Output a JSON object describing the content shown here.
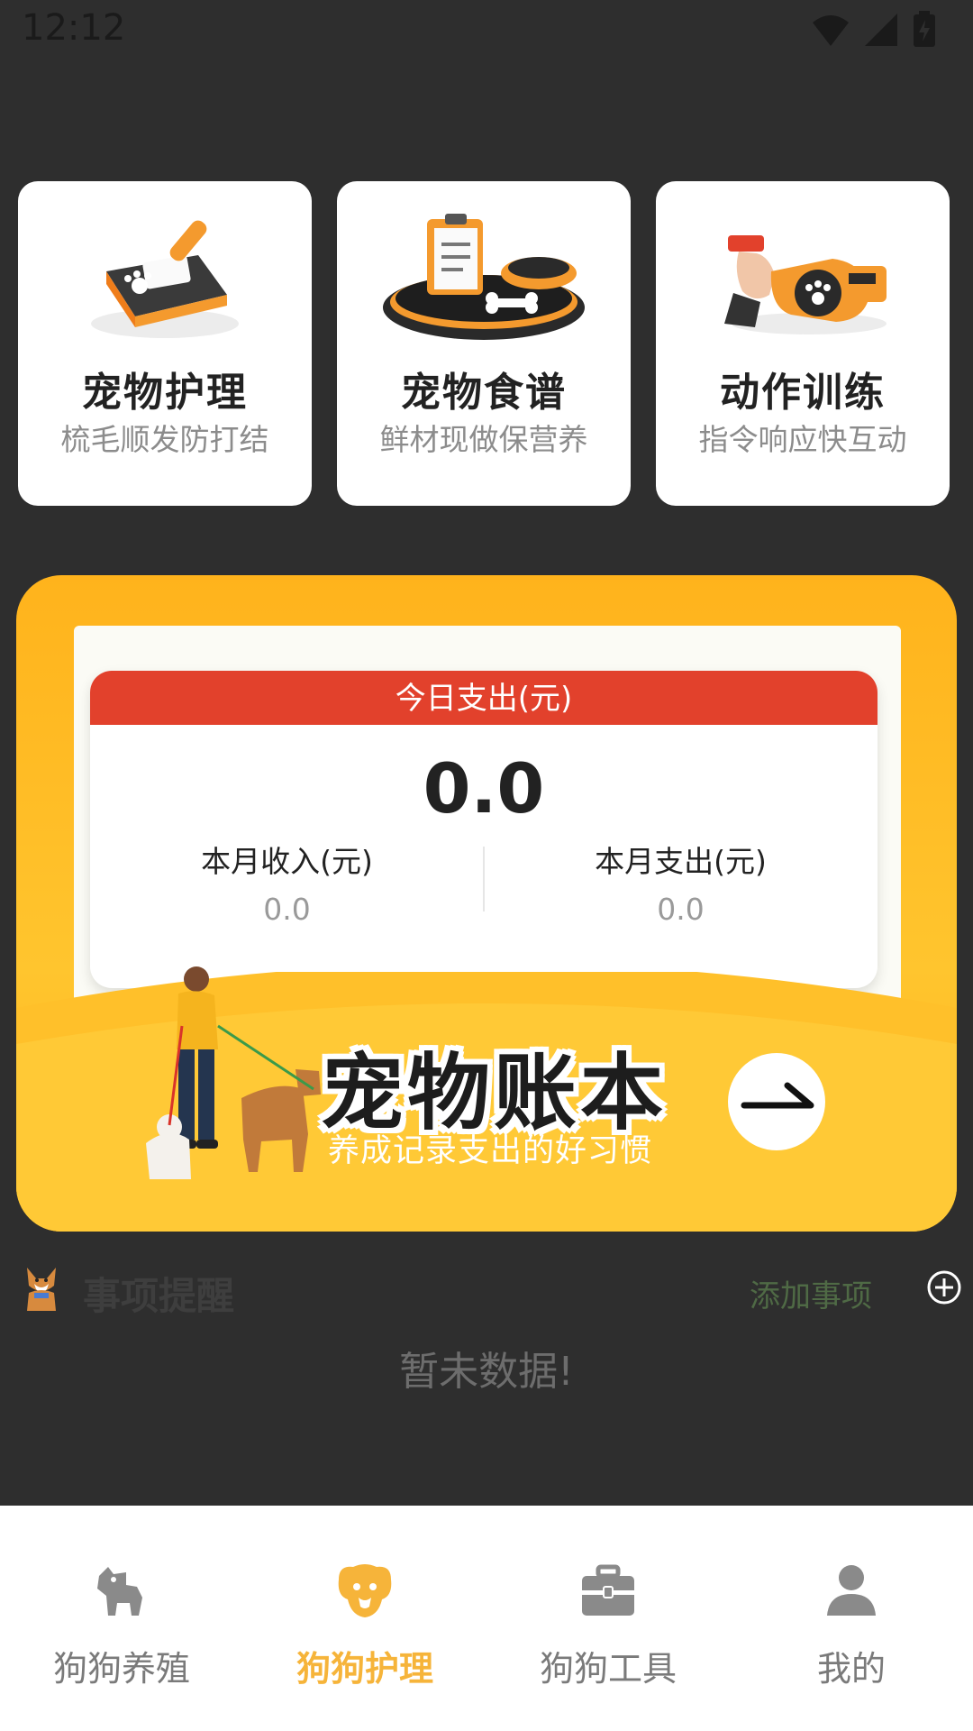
{
  "status_bar": {
    "time": "12:12"
  },
  "features": [
    {
      "title": "宠物护理",
      "subtitle": "梳毛顺发防打结",
      "icon": "grooming-brush-icon"
    },
    {
      "title": "宠物食谱",
      "subtitle": "鲜材现做保营养",
      "icon": "food-bowl-icon"
    },
    {
      "title": "动作训练",
      "subtitle": "指令响应快互动",
      "icon": "whistle-icon"
    }
  ],
  "ledger": {
    "today_label": "今日支出(元)",
    "today_value": "0.0",
    "month_income_label": "本月收入(元)",
    "month_income_value": "0.0",
    "month_expense_label": "本月支出(元)",
    "month_expense_value": "0.0",
    "banner_title": "宠物账本",
    "banner_subtitle": "养成记录支出的好习惯"
  },
  "reminder": {
    "title": "事项提醒",
    "add_label": "添加事项",
    "empty_text": "暂未数据!"
  },
  "tabs": [
    {
      "label": "狗狗养殖",
      "icon": "dog-icon",
      "active": false
    },
    {
      "label": "狗狗护理",
      "icon": "dog-face-icon",
      "active": true
    },
    {
      "label": "狗狗工具",
      "icon": "toolbox-icon",
      "active": false
    },
    {
      "label": "我的",
      "icon": "user-icon",
      "active": false
    }
  ],
  "colors": {
    "accent": "#f6b43a",
    "banner": "#ffb31c",
    "stat_header": "#e2412c",
    "background": "#2e2e2e"
  }
}
